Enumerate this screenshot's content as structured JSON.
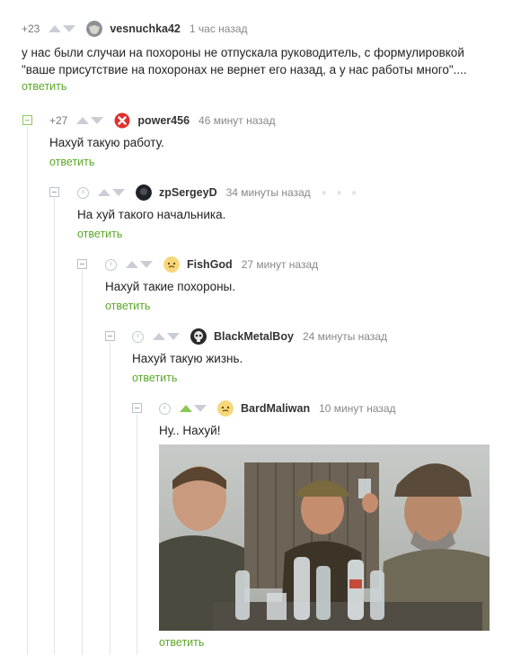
{
  "comments": [
    {
      "rating": "+23",
      "username": "vesnuchka42",
      "time": "1 час назад",
      "text": "у нас были случаи на похороны не отпускала руководитель, с формулировкой \"ваше присутствие на похоронах не вернет его назад, а у нас работы много\"....",
      "reply": "ответить",
      "avatar_icon": "cat-avatar-icon"
    },
    {
      "rating": "+27",
      "username": "power456",
      "time": "46 минут назад",
      "text": "Нахуй такую работу.",
      "reply": "ответить",
      "avatar_icon": "red-x-avatar-icon"
    },
    {
      "username": "zpSergeyD",
      "time": "34 минуты назад",
      "text": "На хуй такого начальника.",
      "reply": "ответить",
      "avatar_icon": "dark-avatar-icon"
    },
    {
      "username": "FishGod",
      "time": "27 минут назад",
      "text": "Нахуй такие похороны.",
      "reply": "ответить",
      "avatar_icon": "yellow-face-avatar-icon"
    },
    {
      "username": "BlackMetalBoy",
      "time": "24 минуты назад",
      "text": "Нахуй такую жизнь.",
      "reply": "ответить",
      "avatar_icon": "skull-avatar-icon"
    },
    {
      "username": "BardMaliwan",
      "time": "10 минут назад",
      "text": "Ну.. Нахуй!",
      "reply": "ответить",
      "avatar_icon": "yellow-face-avatar-icon",
      "image_icon": "movie-still-image"
    }
  ],
  "colors": {
    "accent_green": "#5ca829",
    "vote_gray": "#c9ced6",
    "vote_active": "#8ac858"
  }
}
